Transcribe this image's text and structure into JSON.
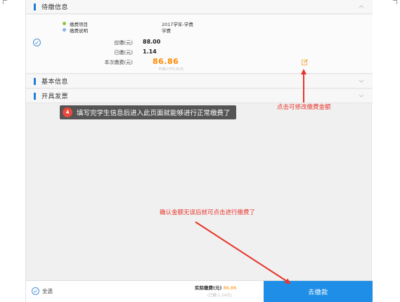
{
  "pending": {
    "title": "待缴信息",
    "item_label": "缴费项目",
    "item_value": "2017学年-学费",
    "desc_label": "缴费说明",
    "desc_value": "学费",
    "due_label": "应缴(元)",
    "due_value": "88.00",
    "paid_label": "已缴(元)",
    "paid_value": "1.14",
    "this_label": "本次缴费(元)",
    "this_value": "86.86",
    "this_hint": "不得小于0.01元"
  },
  "sections": {
    "basic_title": "基本信息",
    "invoice_title": "开具发票"
  },
  "tooltip": {
    "badge": "4",
    "text": "填写完学生信息后进入此页面就能够进行正常缴费了"
  },
  "annotations": {
    "edit_amount": "点击可修改缴费金额",
    "confirm_pay": "确认金额无误后就可点击进行缴费了"
  },
  "bottom": {
    "select_all": "全选",
    "actual_label": "实际缴费(元)",
    "actual_value": "86.86",
    "paid_note": "(已缴:1.14元)",
    "pay_button": "去缴款"
  },
  "colors": {
    "accent": "#1f8ee6",
    "amount": "#ff8a00",
    "annotation": "#e8352b"
  }
}
